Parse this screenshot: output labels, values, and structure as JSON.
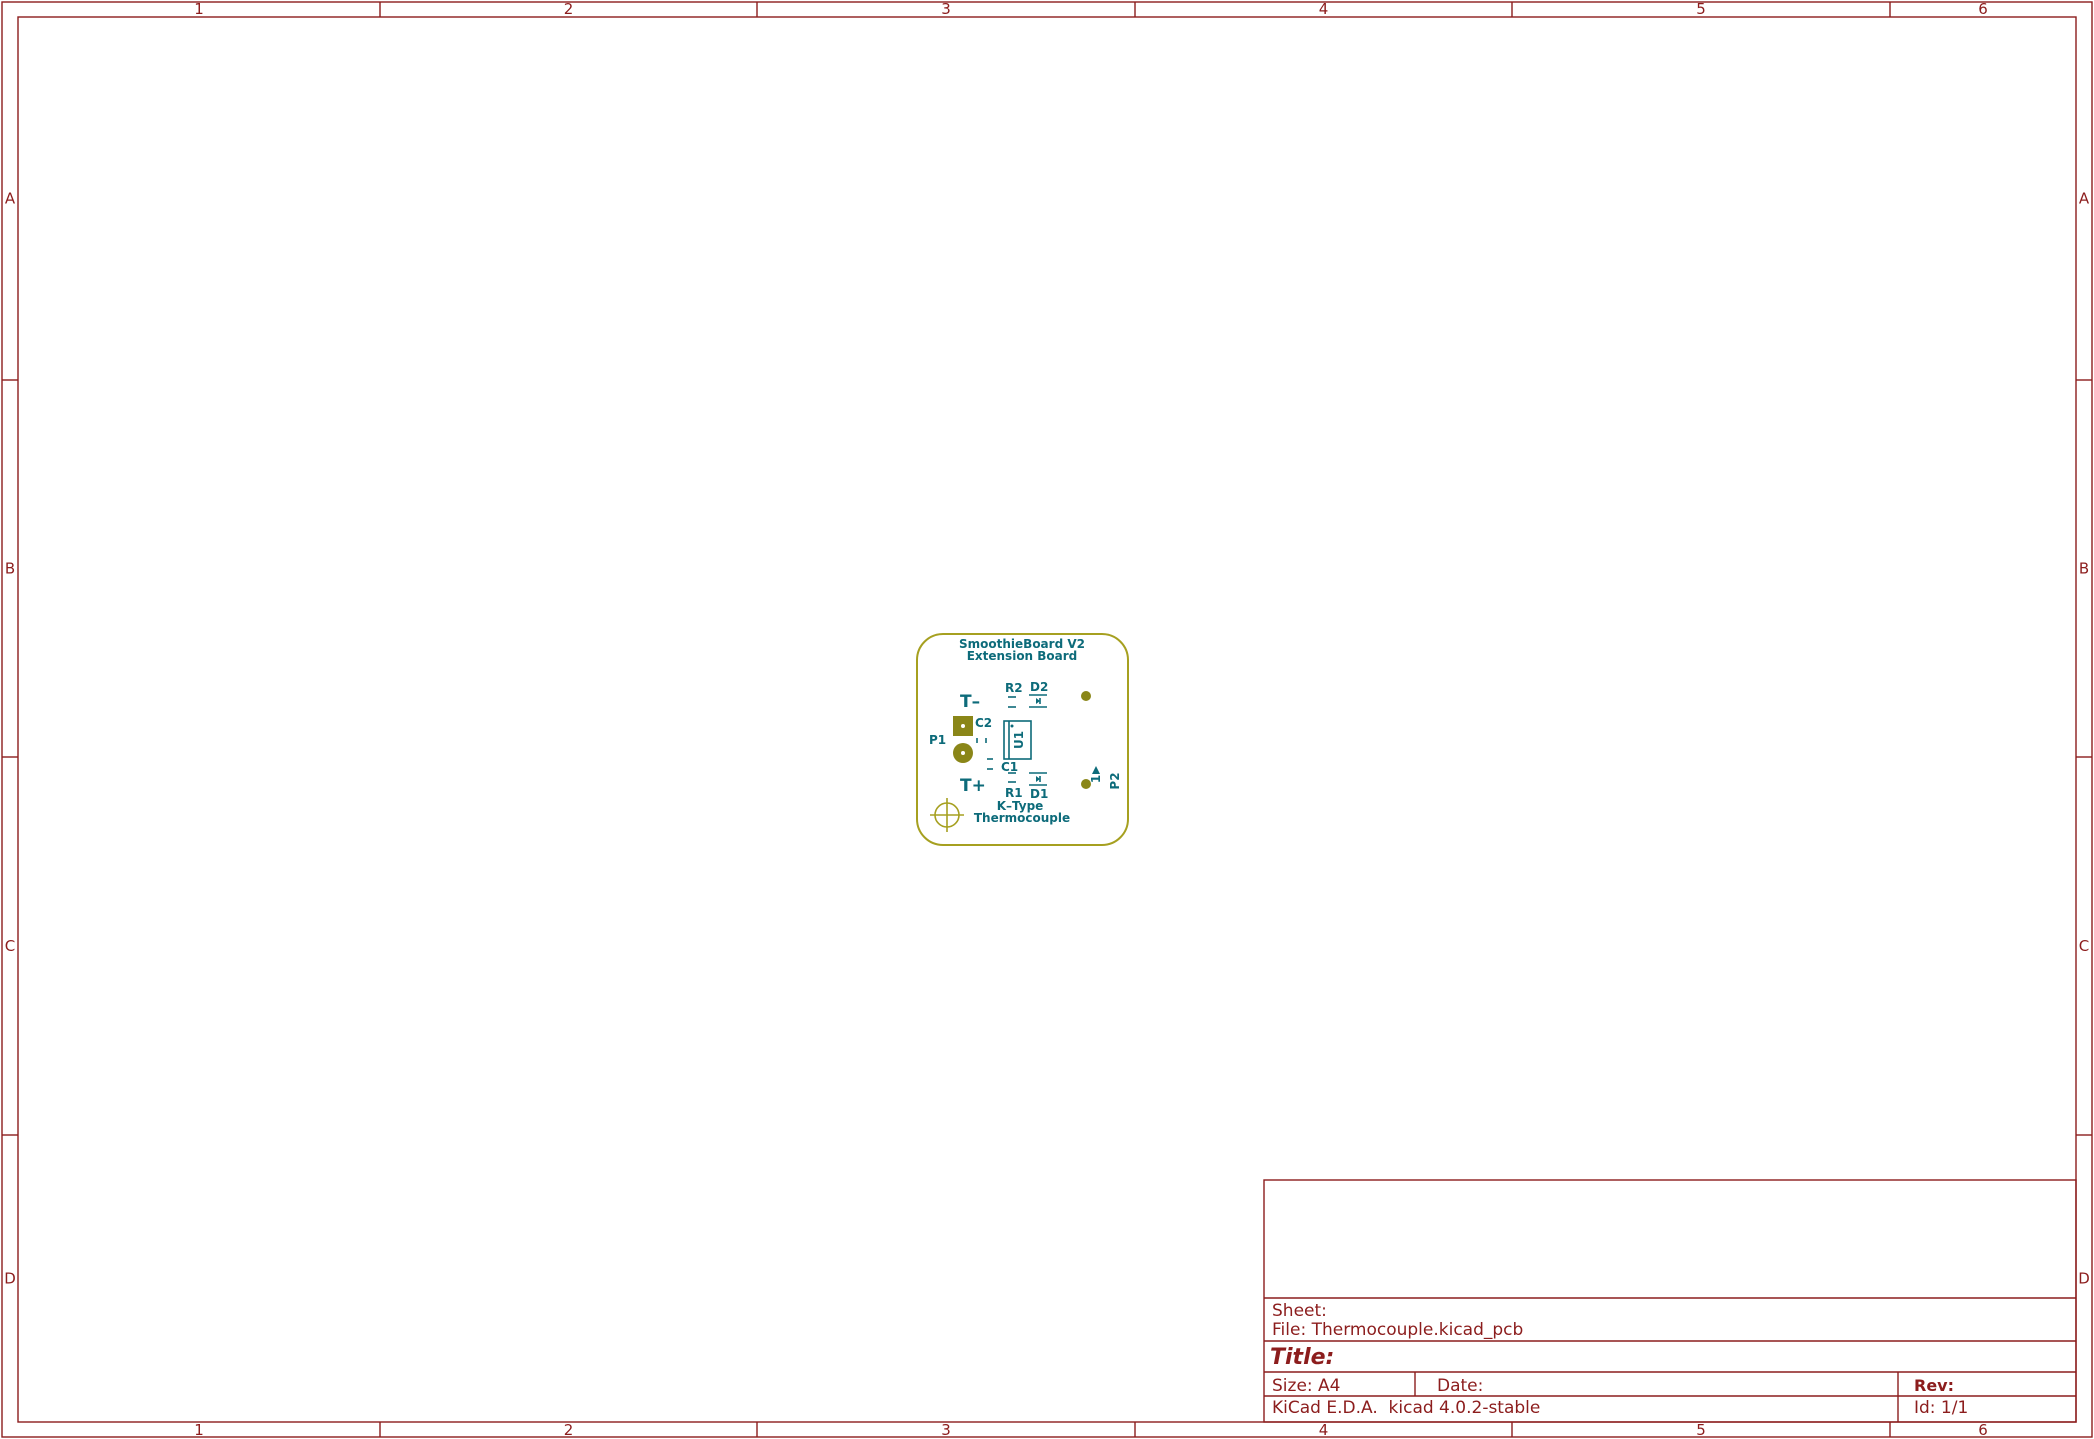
{
  "frame": {
    "columns": [
      "1",
      "2",
      "3",
      "4",
      "5",
      "6"
    ],
    "rows": [
      "A",
      "B",
      "C",
      "D"
    ]
  },
  "title_block": {
    "sheet_label": "Sheet:",
    "file_label": "File: Thermocouple.kicad_pcb",
    "title_label": "Title:",
    "size_label": "Size: A4",
    "date_label": "Date:",
    "rev_label": "Rev:",
    "tool_label": "KiCad E.D.A.  kicad 4.0.2-stable",
    "id_label": "Id: 1/1"
  },
  "pcb": {
    "board_title_line1": "SmoothieBoard V2",
    "board_title_line2": "Extension Board",
    "t_minus": "T–",
    "t_plus": "T+",
    "p1": "P1",
    "p2": "P2",
    "r1": "R1",
    "r2": "R2",
    "c1": "C1",
    "c2": "C2",
    "d1": "D1",
    "d2": "D2",
    "u1": "U1",
    "pin1": "1",
    "bottom_line1": "K–Type",
    "bottom_line2": "Thermocouple",
    "colors": {
      "silkscreen": "#0d6b7a",
      "edge_cuts": "#a6a020",
      "pads": "#8a8618",
      "frame": "#8c1d1d"
    }
  }
}
